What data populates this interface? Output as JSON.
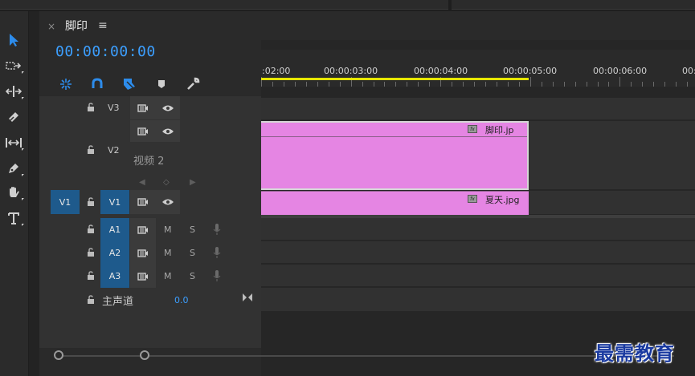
{
  "sequence": {
    "close_label": "×",
    "title": "脚印",
    "menu_label": "≡",
    "timecode": "00:00:00:00"
  },
  "ruler": {
    "labels": [
      ":02:00",
      "00:00:03:00",
      "00:00:04:00",
      "00:00:05:00",
      "00:00:06:00",
      "00:0"
    ]
  },
  "tracks": {
    "v3": {
      "label": "V3"
    },
    "v2": {
      "label": "V2",
      "name": "视频 2"
    },
    "v1": {
      "source": "V1",
      "label": "V1"
    },
    "a1": {
      "label": "A1",
      "m": "M",
      "s": "S"
    },
    "a2": {
      "label": "A2",
      "m": "M",
      "s": "S"
    },
    "a3": {
      "label": "A3",
      "m": "M",
      "s": "S"
    },
    "master": {
      "name": "主声道",
      "value": "0.0"
    }
  },
  "clips": {
    "top": {
      "name": "脚印.jp",
      "fx": "fx"
    },
    "bottom": {
      "name": "夏天.jpg",
      "fx": "fx"
    }
  },
  "colors": {
    "accent": "#3c9fff",
    "track_target": "#1e5a8c",
    "clip": "#e585e3",
    "work_area": "#e6e600"
  },
  "icons": {
    "tools": [
      "selection-tool-icon",
      "track-select-forward-icon",
      "ripple-edit-icon",
      "razor-icon",
      "slip-icon",
      "pen-icon",
      "hand-icon",
      "type-icon"
    ],
    "header": [
      "snap-icon",
      "linked-selection-icon",
      "add-marker-icon",
      "marker-icon",
      "wrench-icon"
    ]
  },
  "watermark": "最需教育"
}
